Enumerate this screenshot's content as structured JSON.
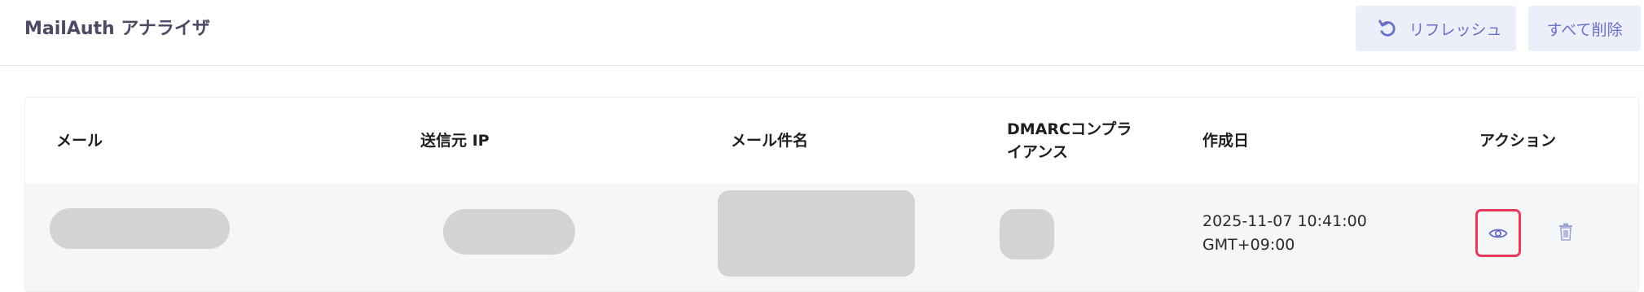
{
  "header": {
    "title": "MailAuth アナライザ",
    "refresh_label": "リフレッシュ",
    "refresh_icon": "refresh-icon",
    "delete_all_label": "すべて削除"
  },
  "table": {
    "columns": [
      "メール",
      "送信元 IP",
      "メール件名",
      "DMARCコンプライアンス",
      "作成日",
      "アクション"
    ],
    "dmarc_header_lines": [
      "DMARCコンプラ",
      "イアンス"
    ],
    "rows": [
      {
        "email": "",
        "sender_ip": "",
        "subject": "",
        "dmarc": "",
        "created_lines": [
          "2025-11-07 10:41:00",
          "GMT+09:00"
        ],
        "actions": [
          "eye-icon",
          "trash-icon"
        ]
      }
    ]
  },
  "colors": {
    "accent": "#6a70c2",
    "button_bg": "#eceef9",
    "highlight_border": "#e8385b",
    "skeleton": "#d3d3d3",
    "row_bg": "#f5f6f8",
    "title": "#4b4b63"
  }
}
